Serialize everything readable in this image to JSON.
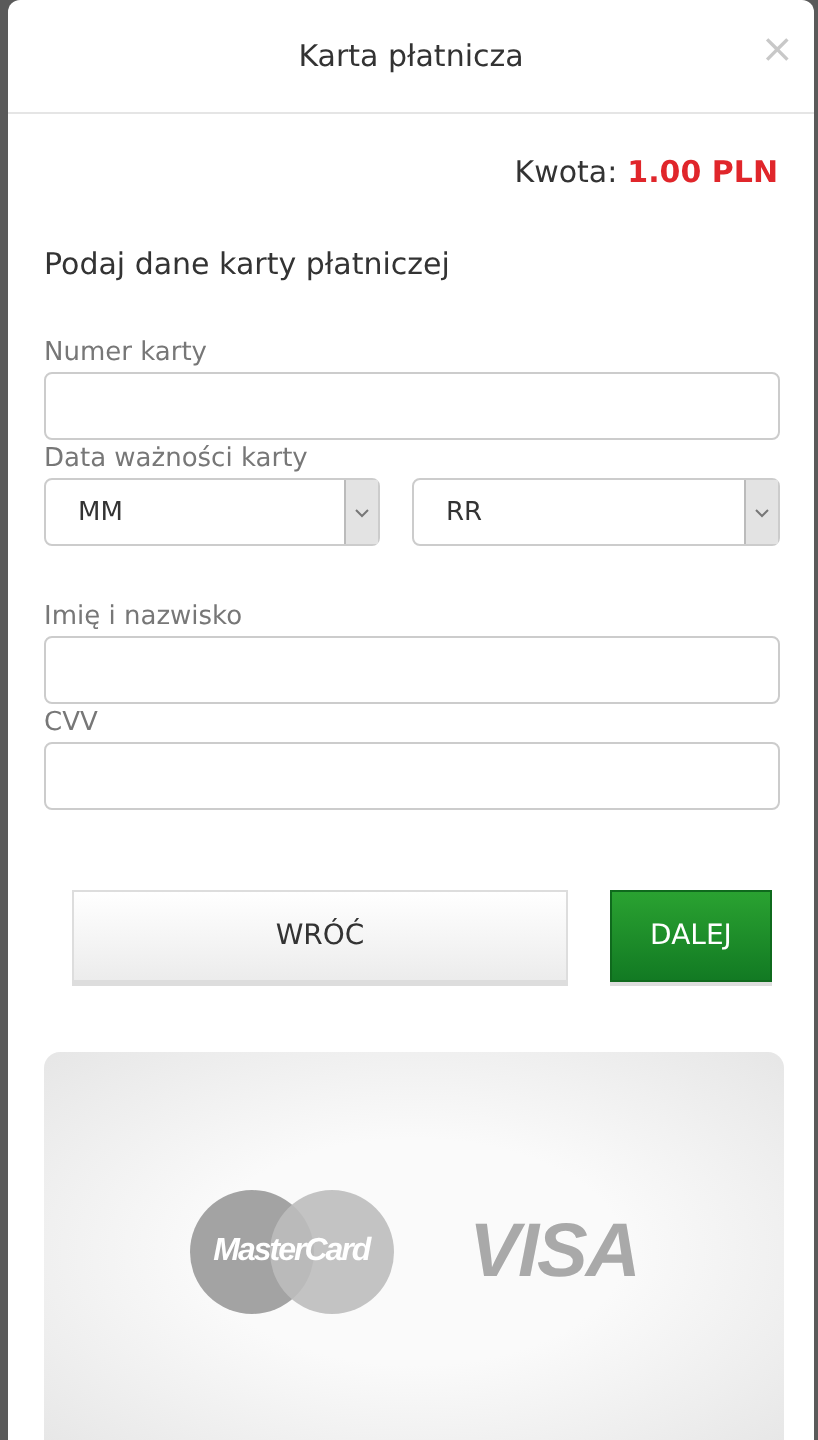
{
  "dialog": {
    "title": "Karta płatnicza",
    "close": "×"
  },
  "amount": {
    "label": "Kwota:",
    "value": "1.00 PLN"
  },
  "heading": "Podaj dane karty płatniczej",
  "fields": [
    {
      "kind": "text",
      "label": "Numer karty"
    },
    {
      "kind": "selects",
      "label": "Data ważności karty",
      "selects": [
        {
          "value": "MM"
        },
        {
          "value": "RR"
        }
      ]
    },
    {
      "kind": "text",
      "label": "Imię i nazwisko"
    },
    {
      "kind": "text",
      "label": "CVV"
    }
  ],
  "buttons": [
    {
      "label": "WRÓĆ",
      "kind": "secondary"
    },
    {
      "label": "DALEJ",
      "kind": "primary"
    }
  ],
  "logos": [
    {
      "kind": "mastercard",
      "text": "MasterCard"
    },
    {
      "kind": "visa",
      "text": "VISA"
    }
  ]
}
